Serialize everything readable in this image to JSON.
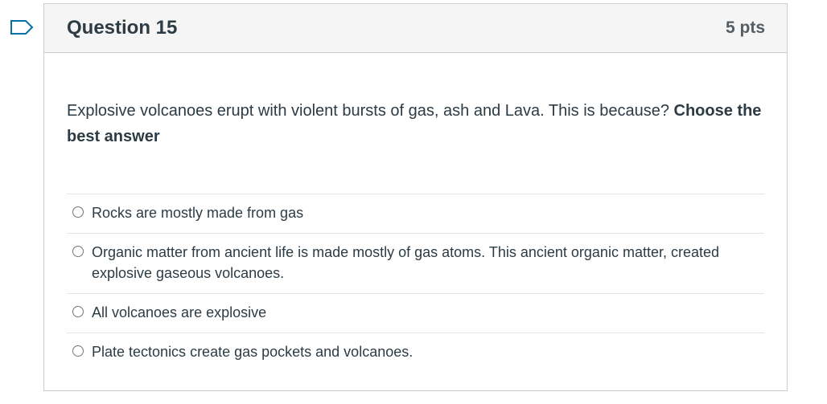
{
  "question": {
    "title": "Question 15",
    "points": "5 pts",
    "text_regular": "Explosive volcanoes erupt with violent bursts of gas, ash and Lava. This is because? ",
    "text_bold": "Choose the best answer",
    "answers": [
      {
        "label": "Rocks are mostly made from gas",
        "selected": false
      },
      {
        "label": "Organic matter from ancient life is made mostly of gas atoms. This ancient organic matter, created explosive gaseous volcanoes.",
        "selected": false
      },
      {
        "label": "All volcanoes are explosive",
        "selected": false
      },
      {
        "label": "Plate tectonics create gas pockets and volcanoes.",
        "selected": false
      }
    ]
  },
  "colors": {
    "header_bg": "#f5f5f5",
    "border": "#c7cdd1",
    "flag": "#0770a3",
    "text": "#2d3b45"
  },
  "icons": {
    "flag": "bookmark-flag-icon",
    "radio": "radio-button-icon"
  }
}
